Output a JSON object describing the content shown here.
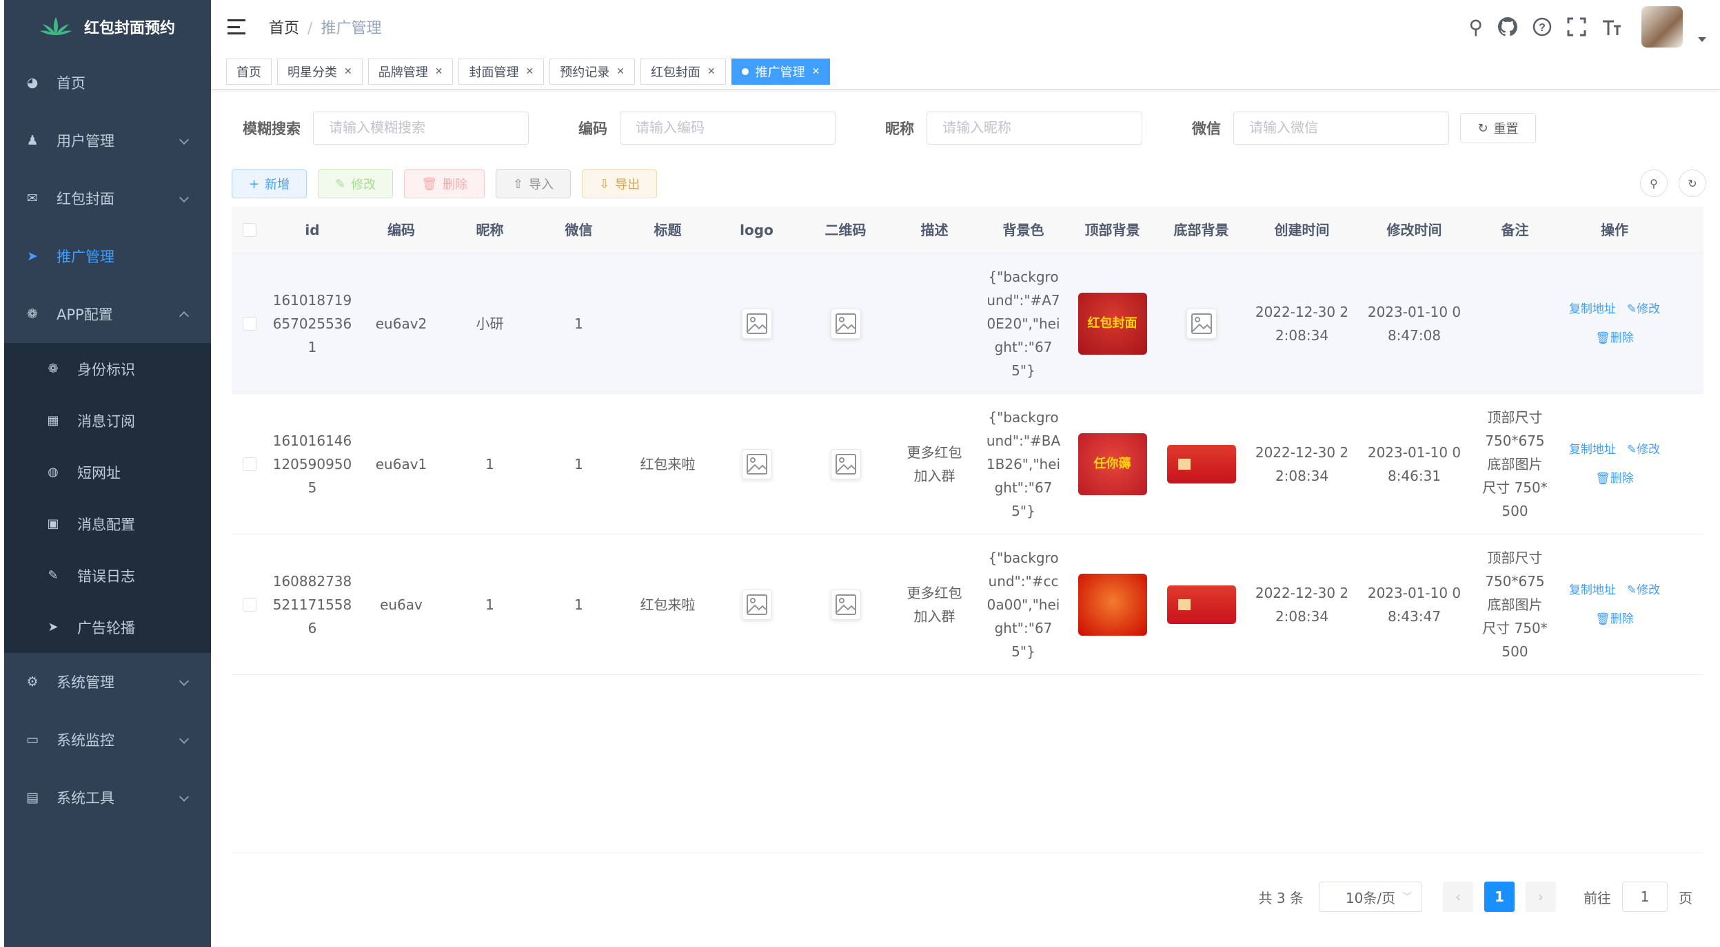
{
  "app": {
    "title": "红包封面预约"
  },
  "sidebar": {
    "items": [
      {
        "label": "首页",
        "icon": "dashboard-icon"
      },
      {
        "label": "用户管理",
        "icon": "user-icon"
      },
      {
        "label": "红包封面",
        "icon": "email-icon"
      },
      {
        "label": "推广管理",
        "icon": "send-icon",
        "active": true
      },
      {
        "label": "APP配置",
        "icon": "wechat-icon"
      }
    ],
    "sub": [
      {
        "label": "身份标识",
        "icon": "wechat-icon"
      },
      {
        "label": "消息订阅",
        "icon": "table-icon"
      },
      {
        "label": "短网址",
        "icon": "globe-icon"
      },
      {
        "label": "消息配置",
        "icon": "message-icon"
      },
      {
        "label": "错误日志",
        "icon": "edit-icon"
      },
      {
        "label": "广告轮播",
        "icon": "send-icon"
      }
    ],
    "bottom": [
      {
        "label": "系统管理",
        "icon": "gear-icon"
      },
      {
        "label": "系统监控",
        "icon": "monitor-icon"
      },
      {
        "label": "系统工具",
        "icon": "tool-icon"
      }
    ]
  },
  "breadcrumb": {
    "home": "首页",
    "current": "推广管理"
  },
  "tags": [
    "首页",
    "明星分类",
    "品牌管理",
    "封面管理",
    "预约记录",
    "红包封面",
    "推广管理"
  ],
  "search": {
    "fuzzy_label": "模糊搜索",
    "fuzzy_ph": "请输入模糊搜索",
    "code_label": "编码",
    "code_ph": "请输入编码",
    "nick_label": "昵称",
    "nick_ph": "请输入昵称",
    "wx_label": "微信",
    "wx_ph": "请输入微信",
    "reset": "重置"
  },
  "toolbar": {
    "add": "新增",
    "edit": "修改",
    "delete": "删除",
    "import": "导入",
    "export": "导出"
  },
  "table": {
    "headers": [
      "id",
      "编码",
      "昵称",
      "微信",
      "标题",
      "logo",
      "二维码",
      "描述",
      "背景色",
      "顶部背景",
      "底部背景",
      "创建时间",
      "修改时间",
      "备注",
      "操作"
    ],
    "rows": [
      {
        "id": [
          "161018719",
          "657025536",
          "1"
        ],
        "code": "eu6av2",
        "nick": "小研",
        "wx": "1",
        "title": "",
        "desc": [
          "",
          ""
        ],
        "bg": [
          "{\"backgro",
          "und\":\"#A7",
          "0E20\",\"hei",
          "ght\":\"67",
          "5\"}"
        ],
        "top_text": "红包封面",
        "bottom_img": false,
        "created": [
          "2022-12-30 2",
          "2:08:34"
        ],
        "modified": [
          "2023-01-10 0",
          "8:47:08"
        ],
        "remark": [
          "",
          "",
          "",
          ""
        ]
      },
      {
        "id": [
          "161016146",
          "120590950",
          "5"
        ],
        "code": "eu6av1",
        "nick": "1",
        "wx": "1",
        "title": "红包来啦",
        "desc": [
          "更多红包",
          "加入群"
        ],
        "bg": [
          "{\"backgro",
          "und\":\"#BA",
          "1B26\",\"hei",
          "ght\":\"67",
          "5\"}"
        ],
        "top_text": "任你薅",
        "bottom_img": true,
        "created": [
          "2022-12-30 2",
          "2:08:34"
        ],
        "modified": [
          "2023-01-10 0",
          "8:46:31"
        ],
        "remark": [
          "顶部尺寸",
          "750*675",
          "底部图片",
          "尺寸 750*",
          "500"
        ]
      },
      {
        "id": [
          "160882738",
          "521171558",
          "6"
        ],
        "code": "eu6av",
        "nick": "1",
        "wx": "1",
        "title": "红包来啦",
        "desc": [
          "更多红包",
          "加入群"
        ],
        "bg": [
          "{\"backgro",
          "und\":\"#cc",
          "0a00\",\"hei",
          "ght\":\"67",
          "5\"}"
        ],
        "top_text": "",
        "bottom_img": true,
        "created": [
          "2022-12-30 2",
          "2:08:34"
        ],
        "modified": [
          "2023-01-10 0",
          "8:43:47"
        ],
        "remark": [
          "顶部尺寸",
          "750*675",
          "底部图片",
          "尺寸 750*",
          "500"
        ]
      }
    ],
    "ops": {
      "copy": "复制地址",
      "edit": "修改",
      "delete": "删除"
    }
  },
  "pager": {
    "total": "共 3 条",
    "size": "10条/页",
    "page": "1",
    "goto": "前往",
    "goto_val": "1",
    "unit": "页"
  },
  "colors": {
    "sidebar": "#304156",
    "submenu": "#1f2d3d",
    "accent": "#409eff"
  }
}
